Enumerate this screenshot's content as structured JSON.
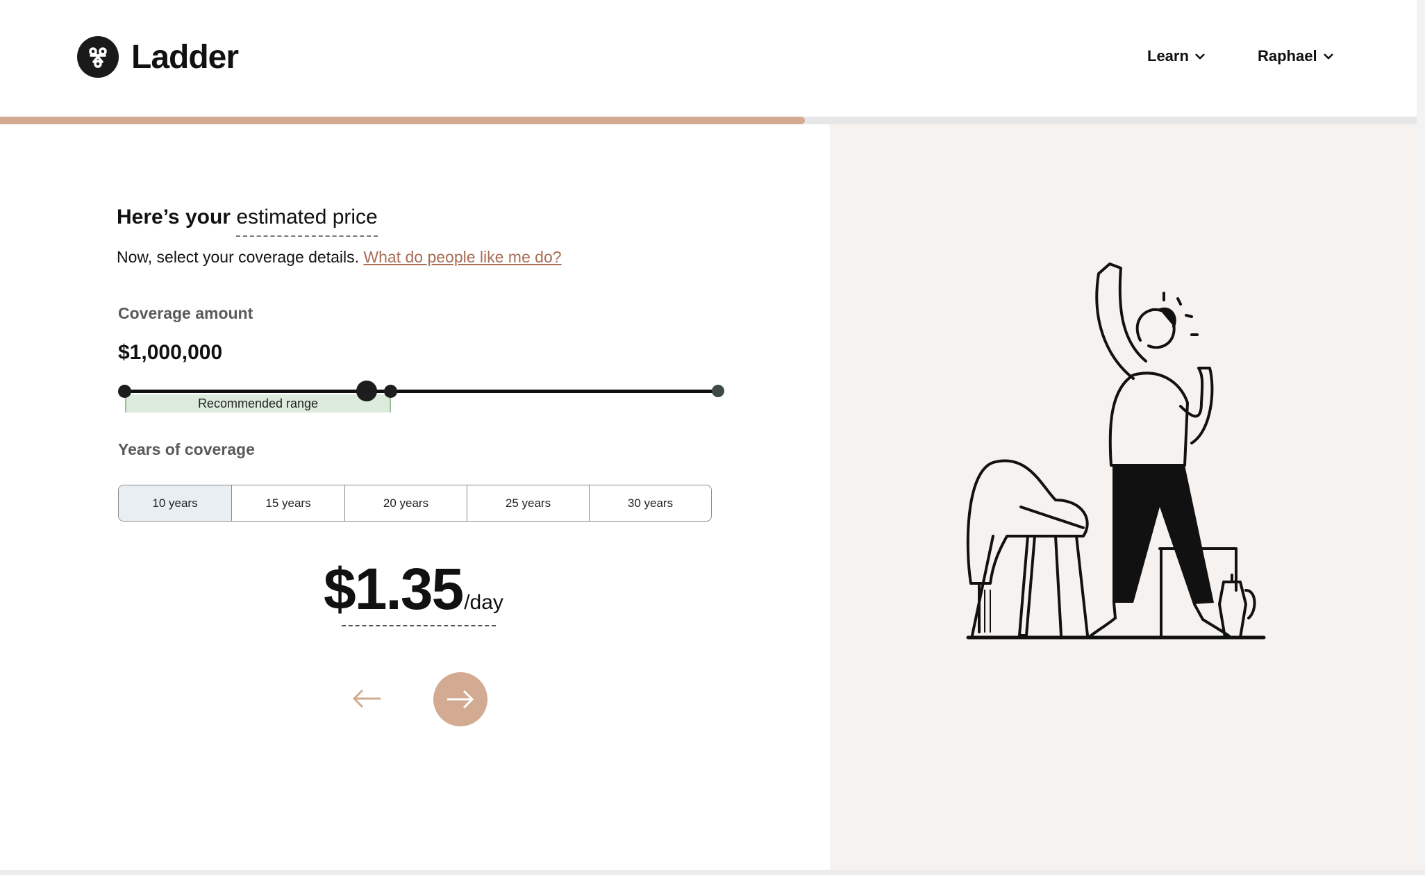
{
  "brand": {
    "name": "Ladder"
  },
  "nav": {
    "learn": "Learn",
    "user": "Raphael"
  },
  "progress": {
    "percent": 56.8,
    "color": "#d2ab92"
  },
  "page": {
    "title_prefix": "Here’s your",
    "title_highlight": "estimated price",
    "subtitle": "Now, select your coverage details.",
    "subtitle_link": "What do people like me do?"
  },
  "coverage": {
    "label": "Coverage amount",
    "amount": "$1,000,000",
    "recommended_label": "Recommended range"
  },
  "years": {
    "label": "Years of coverage",
    "options": [
      "10 years",
      "15 years",
      "20 years",
      "25 years",
      "30 years"
    ],
    "selected": "10 years"
  },
  "price": {
    "value": "$1.35",
    "unit": "/day"
  },
  "colors": {
    "accent": "#d2ab92",
    "link": "#a86d55",
    "panel": "#f6f2ef",
    "recommended": "#dcebdc"
  },
  "icons": {
    "back": "arrow-left-icon",
    "next": "arrow-right-icon",
    "chevron": "chevron-down-icon"
  }
}
